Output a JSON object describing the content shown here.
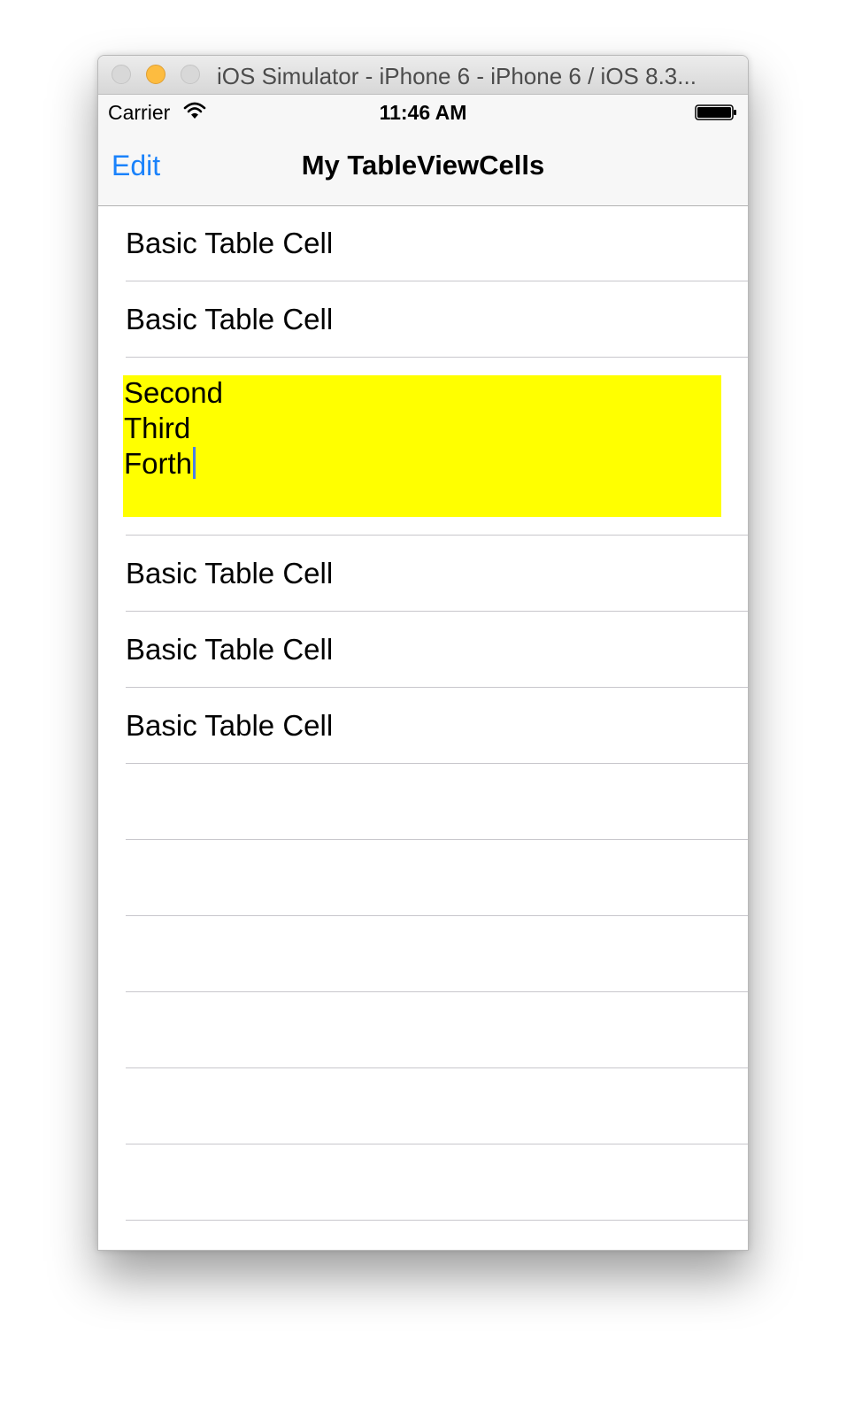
{
  "window": {
    "title": "iOS Simulator - iPhone 6 - iPhone 6 / iOS 8.3..."
  },
  "status_bar": {
    "carrier": "Carrier",
    "time": "11:46 AM",
    "wifi_icon": "wifi-icon",
    "battery_icon": "battery-icon"
  },
  "nav_bar": {
    "edit_label": "Edit",
    "title": "My TableViewCells",
    "accent_color": "#1a82fb"
  },
  "table": {
    "rows_before": [
      "Basic Table Cell",
      "Basic Table Cell"
    ],
    "text_cell": {
      "lines": [
        "Second",
        "Third",
        "Forth"
      ],
      "background": "#ffff00"
    },
    "rows_after": [
      "Basic Table Cell",
      "Basic Table Cell",
      "Basic Table Cell"
    ]
  }
}
